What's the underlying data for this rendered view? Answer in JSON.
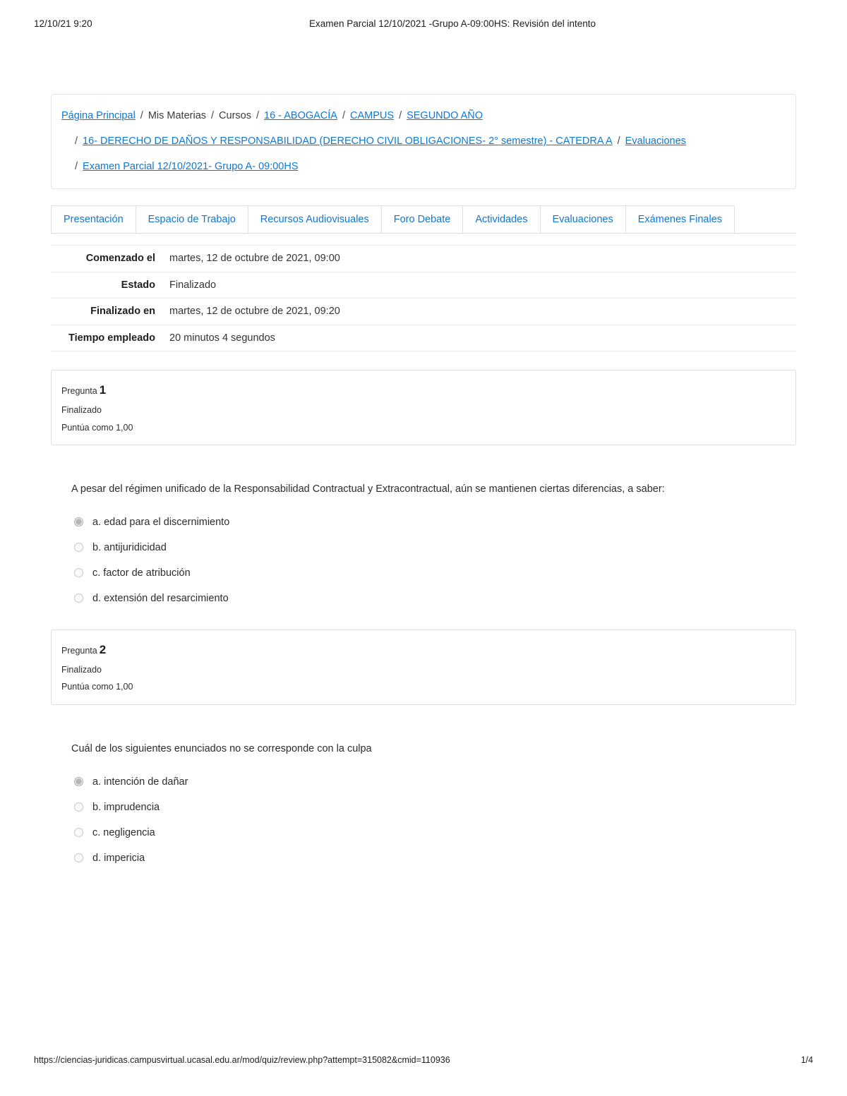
{
  "print_header": {
    "date": "12/10/21 9:20",
    "title": "Examen Parcial 12/10/2021 -Grupo A-09:00HS: Revisión del intento"
  },
  "breadcrumb": {
    "separator": "/",
    "lines": [
      [
        {
          "text": "Página Principal",
          "link": true
        },
        {
          "text": "Mis Materias",
          "link": false
        },
        {
          "text": "Cursos",
          "link": false
        },
        {
          "text": "16 - ABOGACÍA",
          "link": true
        },
        {
          "text": "CAMPUS",
          "link": true
        },
        {
          "text": "SEGUNDO AÑO",
          "link": true
        }
      ],
      [
        {
          "text": "16- DERECHO DE DAÑOS Y RESPONSABILIDAD (DERECHO CIVIL OBLIGACIONES- 2° semestre) - CATEDRA A",
          "link": true
        },
        {
          "text": "Evaluaciones",
          "link": true
        }
      ],
      [
        {
          "text": "Examen Parcial 12/10/2021- Grupo A- 09:00HS",
          "link": true
        }
      ]
    ]
  },
  "tabs": [
    {
      "label": "Presentación"
    },
    {
      "label": "Espacio de Trabajo"
    },
    {
      "label": "Recursos Audiovisuales"
    },
    {
      "label": "Foro Debate"
    },
    {
      "label": "Actividades"
    },
    {
      "label": "Evaluaciones"
    },
    {
      "label": "Exámenes Finales"
    }
  ],
  "attempt_info": [
    {
      "label": "Comenzado el",
      "value": "martes, 12 de octubre de 2021, 09:00"
    },
    {
      "label": "Estado",
      "value": "Finalizado"
    },
    {
      "label": "Finalizado en",
      "value": "martes, 12 de octubre de 2021, 09:20"
    },
    {
      "label": "Tiempo empleado",
      "value": "20 minutos 4 segundos"
    }
  ],
  "questions": [
    {
      "label": "Pregunta",
      "number": "1",
      "state": "Finalizado",
      "grade": "Puntúa como 1,00",
      "text": "A pesar del régimen unificado de la Responsabilidad Contractual y Extracontractual, aún se mantienen ciertas diferencias, a saber:",
      "options": [
        {
          "label": "a. edad para el discernimiento",
          "selected": true
        },
        {
          "label": "b. antijuridicidad",
          "selected": false
        },
        {
          "label": "c. factor de atribución",
          "selected": false
        },
        {
          "label": "d. extensión del resarcimiento",
          "selected": false
        }
      ]
    },
    {
      "label": "Pregunta",
      "number": "2",
      "state": "Finalizado",
      "grade": "Puntúa como 1,00",
      "text": "Cuál de los siguientes enunciados no se corresponde con la culpa",
      "options": [
        {
          "label": "a. intención de dañar",
          "selected": true
        },
        {
          "label": "b. imprudencia",
          "selected": false
        },
        {
          "label": "c. negligencia",
          "selected": false
        },
        {
          "label": "d. impericia",
          "selected": false
        }
      ]
    }
  ],
  "print_footer": {
    "url": "https://ciencias-juridicas.campusvirtual.ucasal.edu.ar/mod/quiz/review.php?attempt=315082&cmid=110936",
    "page": "1/4"
  },
  "colors": {
    "link": "#1177d1",
    "text": "#2c2c2c",
    "border": "#e0e0e0",
    "radio_selected": "#b8b8b8"
  }
}
